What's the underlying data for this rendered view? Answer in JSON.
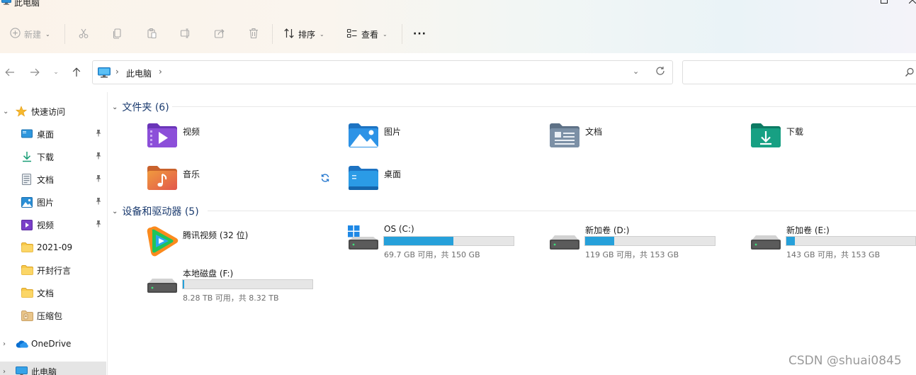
{
  "window": {
    "title": "此电脑"
  },
  "toolbar": {
    "new_label": "新建",
    "sort_label": "排序",
    "view_label": "查看",
    "more_label": "···"
  },
  "address": {
    "crumb": "此电脑",
    "search_placeholder": ""
  },
  "sidebar": {
    "quick_access": "快速访问",
    "items": [
      {
        "label": "桌面",
        "icon": "desktop-icon",
        "pinned": true
      },
      {
        "label": "下载",
        "icon": "download-icon",
        "pinned": true
      },
      {
        "label": "文档",
        "icon": "document-icon",
        "pinned": true
      },
      {
        "label": "图片",
        "icon": "pictures-icon",
        "pinned": true
      },
      {
        "label": "视频",
        "icon": "videos-icon",
        "pinned": true
      },
      {
        "label": "2021-09",
        "icon": "folder-icon",
        "pinned": false
      },
      {
        "label": "开封行言",
        "icon": "folder-icon",
        "pinned": false
      },
      {
        "label": "文档",
        "icon": "folder-icon",
        "pinned": false
      },
      {
        "label": "压缩包",
        "icon": "zip-folder-icon",
        "pinned": false
      }
    ],
    "onedrive": "OneDrive",
    "this_pc": "此电脑"
  },
  "folders": {
    "header": "文件夹 (6)",
    "items": [
      {
        "name": "视频",
        "icon": "videos-folder-icon"
      },
      {
        "name": "图片",
        "icon": "pictures-folder-icon"
      },
      {
        "name": "文档",
        "icon": "documents-folder-icon"
      },
      {
        "name": "下载",
        "icon": "downloads-folder-icon"
      },
      {
        "name": "音乐",
        "icon": "music-folder-icon"
      },
      {
        "name": "桌面",
        "icon": "desktop-folder-icon"
      }
    ]
  },
  "devices": {
    "header": "设备和驱动器 (5)",
    "app": {
      "name": "腾讯视频 (32 位)",
      "icon": "tencent-video-icon"
    },
    "drives": [
      {
        "name": "OS (C:)",
        "caption": "69.7 GB 可用，共 150 GB",
        "used_fraction": 0.535,
        "windows": true
      },
      {
        "name": "新加卷 (D:)",
        "caption": "119 GB 可用，共 153 GB",
        "used_fraction": 0.222
      },
      {
        "name": "新加卷 (E:)",
        "caption": "143 GB 可用，共 153 GB",
        "used_fraction": 0.065
      },
      {
        "name": "本地磁盘 (F:)",
        "caption": "8.28 TB 可用，共 8.32 TB",
        "used_fraction": 0.005
      }
    ]
  },
  "watermark": "CSDN @shuai0845",
  "colors": {
    "accent": "#26a0da",
    "group_header": "#1b3b6f"
  }
}
